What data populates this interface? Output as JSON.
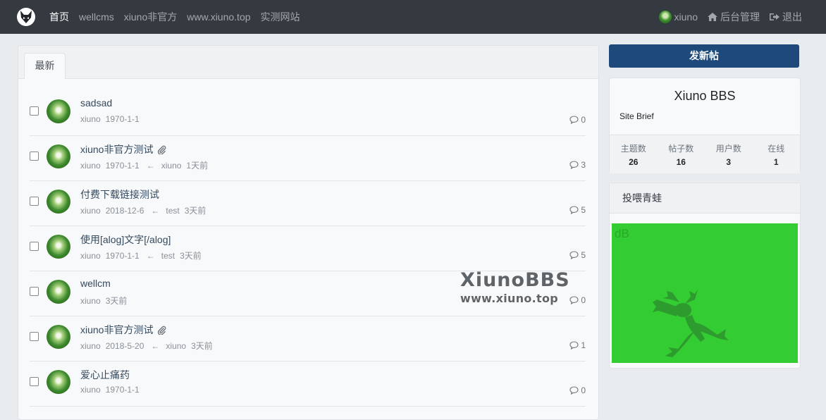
{
  "nav": {
    "links": [
      "首页",
      "wellcms",
      "xiuno非官方",
      "www.xiuno.top",
      "实测网站"
    ],
    "user": "xiuno",
    "admin": "后台管理",
    "logout": "退出"
  },
  "tabs": [
    "最新"
  ],
  "threads": [
    {
      "subject": "sadsad",
      "author": "xiuno",
      "date": "1970-1-1",
      "last_user": "",
      "last_time": "",
      "replies": "0",
      "attachment": false
    },
    {
      "subject": "xiuno非官方测试",
      "author": "xiuno",
      "date": "1970-1-1",
      "last_user": "xiuno",
      "last_time": "1天前",
      "replies": "3",
      "attachment": true
    },
    {
      "subject": "付费下载链接测试",
      "author": "xiuno",
      "date": "2018-12-6",
      "last_user": "test",
      "last_time": "3天前",
      "replies": "5",
      "attachment": false
    },
    {
      "subject": "使用[alog]文字[/alog]",
      "author": "xiuno",
      "date": "1970-1-1",
      "last_user": "test",
      "last_time": "3天前",
      "replies": "5",
      "attachment": false
    },
    {
      "subject": "wellcm",
      "author": "xiuno",
      "date": "3天前",
      "last_user": "",
      "last_time": "",
      "replies": "0",
      "attachment": false
    },
    {
      "subject": "xiuno非官方测试",
      "author": "xiuno",
      "date": "2018-5-20",
      "last_user": "xiuno",
      "last_time": "3天前",
      "replies": "1",
      "attachment": true
    },
    {
      "subject": "爱心止痛药",
      "author": "xiuno",
      "date": "1970-1-1",
      "last_user": "",
      "last_time": "",
      "replies": "0",
      "attachment": false
    }
  ],
  "watermark": {
    "line1": "XiunoBBS",
    "line2": "www.xiuno.top"
  },
  "sidebar": {
    "new_thread": "发新帖",
    "site_name": "Xiuno BBS",
    "site_brief": "Site Brief",
    "stats": [
      {
        "label": "主题数",
        "value": "26"
      },
      {
        "label": "帖子数",
        "value": "16"
      },
      {
        "label": "用户数",
        "value": "3"
      },
      {
        "label": "在线",
        "value": "1"
      }
    ],
    "ad_title": "投喂青蛙",
    "ad_text": "dB"
  },
  "colors": {
    "navbar": "#343a40",
    "primary_button": "#1d4a7a",
    "ad_background": "#33cc33"
  }
}
